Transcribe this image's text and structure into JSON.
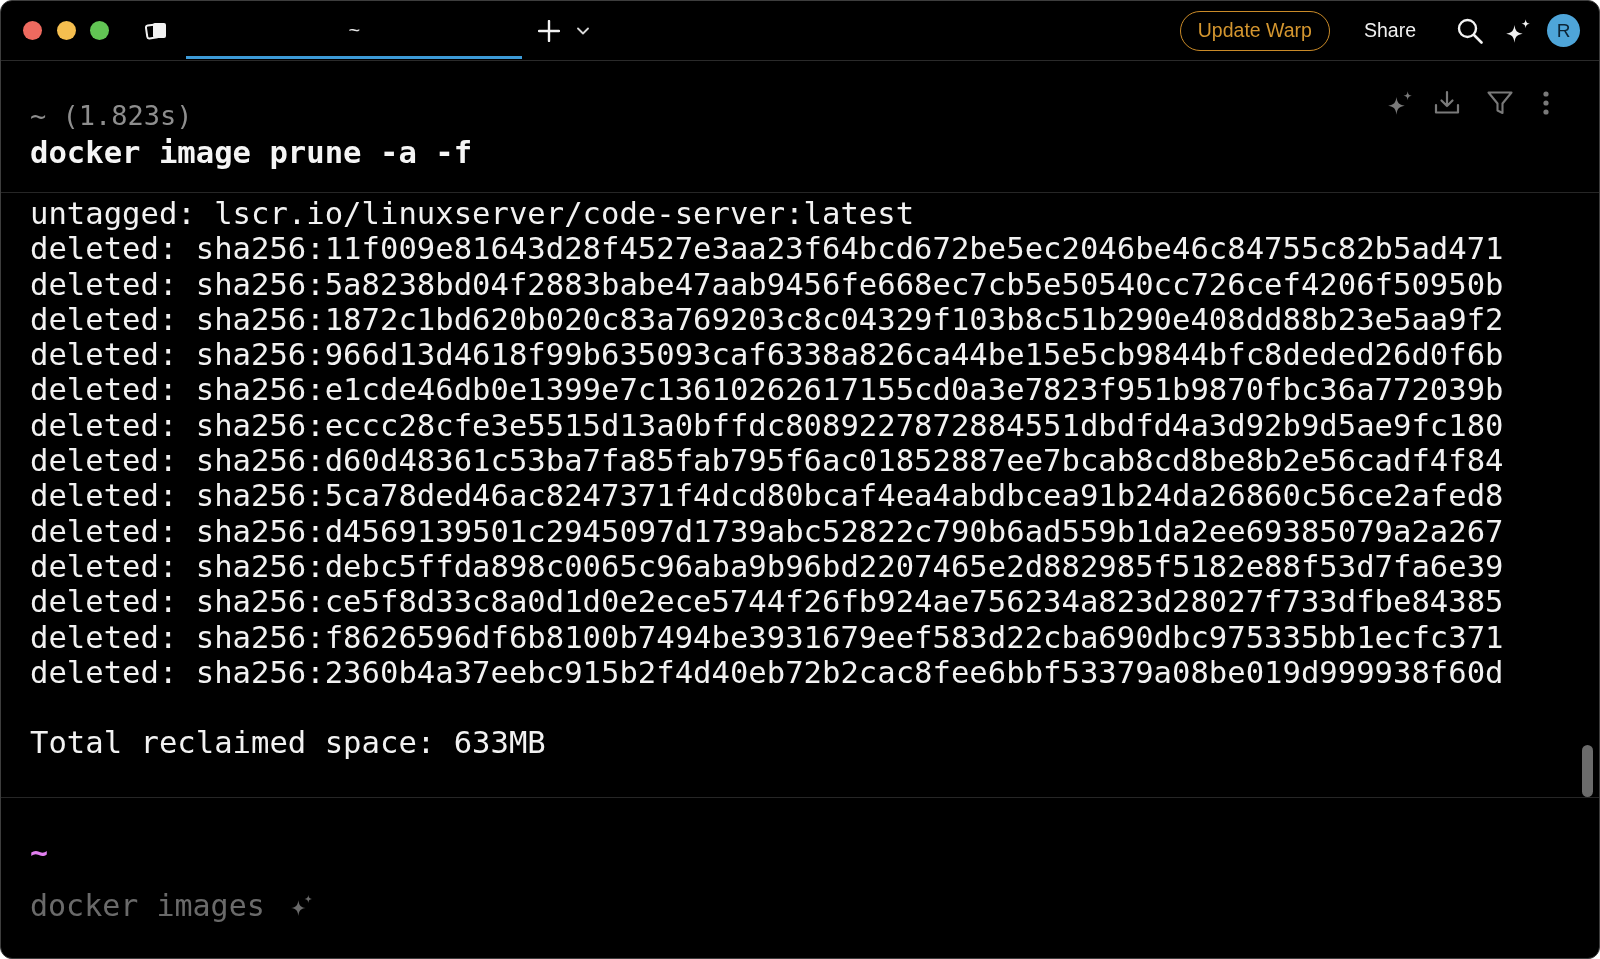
{
  "tabs": [
    {
      "label": "~",
      "selected": true
    }
  ],
  "toolbar": {
    "update_button": "Update Warp",
    "share_button": "Share",
    "avatar": "R"
  },
  "blocks": [
    {
      "header": "~ (1.823s)",
      "command": "docker image prune -a -f",
      "output": [
        "untagged: lscr.io/linuxserver/code-server:latest",
        "deleted: sha256:11f009e81643d28f4527e3aa23f64bcd672be5ec2046be46c84755c82b5ad471",
        "deleted: sha256:5a8238bd04f2883babe47aab9456fe668ec7cb5e50540cc726cef4206f50950b",
        "deleted: sha256:1872c1bd620b020c83a769203c8c04329f103b8c51b290e408dd88b23e5aa9f2",
        "deleted: sha256:966d13d4618f99b635093caf6338a826ca44be15e5cb9844bfc8deded26d0f6b",
        "deleted: sha256:e1cde46db0e1399e7c13610262617155cd0a3e7823f951b9870fbc36a772039b",
        "deleted: sha256:eccc28cfe3e5515d13a0bffdc8089227872884551dbdfd4a3d92b9d5ae9fc180",
        "deleted: sha256:d60d48361c53ba7fa85fab795f6ac01852887ee7bcab8cd8be8b2e56cadf4f84",
        "deleted: sha256:5ca78ded46ac8247371f4dcd80bcaf4ea4abdbcea91b24da26860c56ce2afed8",
        "deleted: sha256:d4569139501c2945097d1739abc52822c790b6ad559b1da2ee69385079a2a267",
        "deleted: sha256:debc5ffda898c0065c96aba9b96bd2207465e2d882985f5182e88f53d7fa6e39",
        "deleted: sha256:ce5f8d33c8a0d1d0e2ece5744f26fb924ae756234a823d28027f733dfbe84385",
        "deleted: sha256:f8626596df6b8100b7494be3931679eef583d22cba690dbc975335bb1ecfc371",
        "deleted: sha256:2360b4a37eebc915b2f4d40eb72b2cac8fee6bbf53379a08be019d999938f60d"
      ],
      "summary": "Total reclaimed space: 633MB"
    }
  ],
  "input": {
    "prompt": "~",
    "placeholder": "docker images"
  }
}
